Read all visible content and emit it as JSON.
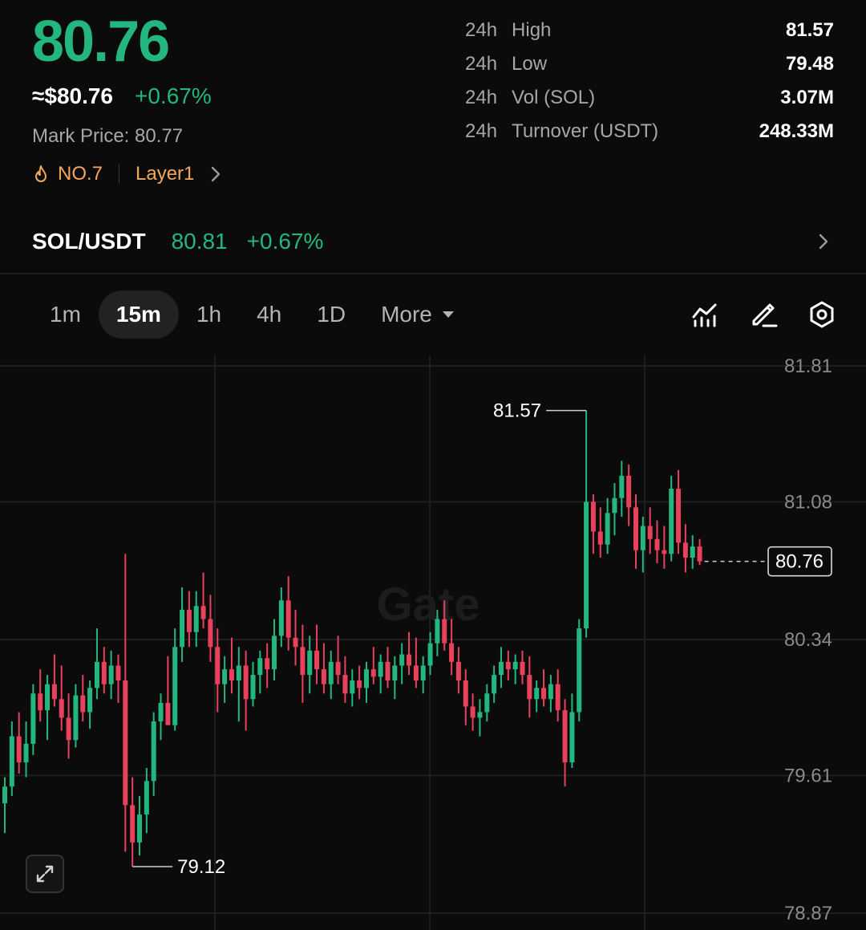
{
  "colors": {
    "up": "#23b77f",
    "down": "#e8415c",
    "accent": "#f5a65b",
    "bg": "#0b0b0b"
  },
  "header": {
    "last_price": "80.76",
    "usd_price": "≈$80.76",
    "change_pct": "+0.67%",
    "mark_price": "Mark Price: 80.77",
    "rank_label": "NO.7",
    "sector_label": "Layer1",
    "icons": {
      "rank": "fire-icon",
      "sector_more": "chevron-right-icon"
    }
  },
  "stats": [
    {
      "period": "24h",
      "label": "High",
      "value": "81.57"
    },
    {
      "period": "24h",
      "label": "Low",
      "value": "79.48"
    },
    {
      "period": "24h",
      "label": "Vol (SOL)",
      "value": "3.07M"
    },
    {
      "period": "24h",
      "label": "Turnover (USDT)",
      "value": "248.33M"
    }
  ],
  "spot_pair": {
    "name": "SOL/USDT",
    "price": "80.81",
    "change": "+0.67%",
    "icon": "chevron-right-icon"
  },
  "timeframes": {
    "tabs": [
      "1m",
      "15m",
      "1h",
      "4h",
      "1D"
    ],
    "active": "15m",
    "more_label": "More",
    "tools": [
      "indicators-icon",
      "draw-icon",
      "settings-icon"
    ]
  },
  "chart_data": {
    "type": "candlestick",
    "watermark": "Gate",
    "y_axis_ticks": [
      "81.81",
      "81.08",
      "80.34",
      "79.61",
      "78.87"
    ],
    "ylim": [
      78.87,
      81.81
    ],
    "high_marker": "81.57",
    "low_marker": "79.12",
    "current_price_label": "80.76",
    "grid": true,
    "candles": [
      {
        "o": 79.46,
        "h": 79.6,
        "l": 79.3,
        "c": 79.55
      },
      {
        "o": 79.55,
        "h": 79.9,
        "l": 79.5,
        "c": 79.82
      },
      {
        "o": 79.82,
        "h": 79.95,
        "l": 79.62,
        "c": 79.68
      },
      {
        "o": 79.68,
        "h": 79.9,
        "l": 79.6,
        "c": 79.78
      },
      {
        "o": 79.78,
        "h": 80.1,
        "l": 79.72,
        "c": 80.05
      },
      {
        "o": 80.05,
        "h": 80.18,
        "l": 79.9,
        "c": 79.96
      },
      {
        "o": 79.96,
        "h": 80.15,
        "l": 79.8,
        "c": 80.1
      },
      {
        "o": 80.1,
        "h": 80.26,
        "l": 79.98,
        "c": 80.02
      },
      {
        "o": 80.02,
        "h": 80.2,
        "l": 79.85,
        "c": 79.92
      },
      {
        "o": 79.92,
        "h": 80.05,
        "l": 79.7,
        "c": 79.8
      },
      {
        "o": 79.8,
        "h": 80.1,
        "l": 79.76,
        "c": 80.04
      },
      {
        "o": 80.04,
        "h": 80.15,
        "l": 79.9,
        "c": 79.95
      },
      {
        "o": 79.95,
        "h": 80.12,
        "l": 79.86,
        "c": 80.08
      },
      {
        "o": 80.08,
        "h": 80.4,
        "l": 80.02,
        "c": 80.22
      },
      {
        "o": 80.22,
        "h": 80.3,
        "l": 80.05,
        "c": 80.1
      },
      {
        "o": 80.1,
        "h": 80.28,
        "l": 80.02,
        "c": 80.2
      },
      {
        "o": 80.2,
        "h": 80.26,
        "l": 80.0,
        "c": 80.12
      },
      {
        "o": 80.12,
        "h": 80.8,
        "l": 79.2,
        "c": 79.45
      },
      {
        "o": 79.45,
        "h": 79.6,
        "l": 79.12,
        "c": 79.25
      },
      {
        "o": 79.25,
        "h": 79.5,
        "l": 79.18,
        "c": 79.4
      },
      {
        "o": 79.4,
        "h": 79.65,
        "l": 79.3,
        "c": 79.58
      },
      {
        "o": 79.58,
        "h": 79.95,
        "l": 79.5,
        "c": 79.9
      },
      {
        "o": 79.9,
        "h": 80.05,
        "l": 79.8,
        "c": 80.0
      },
      {
        "o": 80.0,
        "h": 80.25,
        "l": 79.95,
        "c": 79.88
      },
      {
        "o": 79.88,
        "h": 80.4,
        "l": 79.85,
        "c": 80.3
      },
      {
        "o": 80.3,
        "h": 80.62,
        "l": 80.22,
        "c": 80.5
      },
      {
        "o": 80.5,
        "h": 80.6,
        "l": 80.3,
        "c": 80.38
      },
      {
        "o": 80.38,
        "h": 80.6,
        "l": 80.3,
        "c": 80.52
      },
      {
        "o": 80.52,
        "h": 80.7,
        "l": 80.4,
        "c": 80.45
      },
      {
        "o": 80.45,
        "h": 80.58,
        "l": 80.22,
        "c": 80.3
      },
      {
        "o": 80.3,
        "h": 80.4,
        "l": 79.95,
        "c": 80.1
      },
      {
        "o": 80.1,
        "h": 80.25,
        "l": 80.0,
        "c": 80.18
      },
      {
        "o": 80.18,
        "h": 80.35,
        "l": 80.05,
        "c": 80.12
      },
      {
        "o": 80.12,
        "h": 80.3,
        "l": 79.9,
        "c": 80.2
      },
      {
        "o": 80.2,
        "h": 80.28,
        "l": 79.85,
        "c": 80.02
      },
      {
        "o": 80.02,
        "h": 80.22,
        "l": 79.98,
        "c": 80.15
      },
      {
        "o": 80.15,
        "h": 80.28,
        "l": 80.05,
        "c": 80.24
      },
      {
        "o": 80.24,
        "h": 80.32,
        "l": 80.08,
        "c": 80.18
      },
      {
        "o": 80.18,
        "h": 80.45,
        "l": 80.12,
        "c": 80.36
      },
      {
        "o": 80.36,
        "h": 80.62,
        "l": 80.3,
        "c": 80.55
      },
      {
        "o": 80.55,
        "h": 80.68,
        "l": 80.28,
        "c": 80.35
      },
      {
        "o": 80.35,
        "h": 80.5,
        "l": 80.2,
        "c": 80.3
      },
      {
        "o": 80.3,
        "h": 80.42,
        "l": 80.0,
        "c": 80.15
      },
      {
        "o": 80.15,
        "h": 80.36,
        "l": 80.05,
        "c": 80.28
      },
      {
        "o": 80.28,
        "h": 80.42,
        "l": 80.1,
        "c": 80.18
      },
      {
        "o": 80.18,
        "h": 80.32,
        "l": 80.05,
        "c": 80.1
      },
      {
        "o": 80.1,
        "h": 80.28,
        "l": 80.02,
        "c": 80.22
      },
      {
        "o": 80.22,
        "h": 80.36,
        "l": 80.1,
        "c": 80.15
      },
      {
        "o": 80.15,
        "h": 80.25,
        "l": 80.0,
        "c": 80.05
      },
      {
        "o": 80.05,
        "h": 80.18,
        "l": 79.98,
        "c": 80.12
      },
      {
        "o": 80.12,
        "h": 80.2,
        "l": 80.02,
        "c": 80.08
      },
      {
        "o": 80.08,
        "h": 80.22,
        "l": 80.0,
        "c": 80.18
      },
      {
        "o": 80.18,
        "h": 80.3,
        "l": 80.1,
        "c": 80.14
      },
      {
        "o": 80.14,
        "h": 80.26,
        "l": 80.05,
        "c": 80.22
      },
      {
        "o": 80.22,
        "h": 80.3,
        "l": 80.08,
        "c": 80.12
      },
      {
        "o": 80.12,
        "h": 80.25,
        "l": 80.02,
        "c": 80.2
      },
      {
        "o": 80.2,
        "h": 80.32,
        "l": 80.1,
        "c": 80.26
      },
      {
        "o": 80.26,
        "h": 80.38,
        "l": 80.15,
        "c": 80.2
      },
      {
        "o": 80.2,
        "h": 80.35,
        "l": 80.08,
        "c": 80.12
      },
      {
        "o": 80.12,
        "h": 80.25,
        "l": 80.05,
        "c": 80.2
      },
      {
        "o": 80.2,
        "h": 80.38,
        "l": 80.15,
        "c": 80.32
      },
      {
        "o": 80.32,
        "h": 80.5,
        "l": 80.25,
        "c": 80.45
      },
      {
        "o": 80.45,
        "h": 80.55,
        "l": 80.28,
        "c": 80.32
      },
      {
        "o": 80.32,
        "h": 80.45,
        "l": 80.15,
        "c": 80.22
      },
      {
        "o": 80.22,
        "h": 80.3,
        "l": 80.05,
        "c": 80.12
      },
      {
        "o": 80.12,
        "h": 80.18,
        "l": 79.88,
        "c": 79.98
      },
      {
        "o": 79.98,
        "h": 80.05,
        "l": 79.85,
        "c": 79.92
      },
      {
        "o": 79.92,
        "h": 80.02,
        "l": 79.82,
        "c": 79.95
      },
      {
        "o": 79.95,
        "h": 80.1,
        "l": 79.9,
        "c": 80.05
      },
      {
        "o": 80.05,
        "h": 80.2,
        "l": 80.0,
        "c": 80.15
      },
      {
        "o": 80.15,
        "h": 80.3,
        "l": 80.08,
        "c": 80.22
      },
      {
        "o": 80.22,
        "h": 80.28,
        "l": 80.12,
        "c": 80.18
      },
      {
        "o": 80.18,
        "h": 80.26,
        "l": 80.1,
        "c": 80.22
      },
      {
        "o": 80.22,
        "h": 80.28,
        "l": 80.1,
        "c": 80.15
      },
      {
        "o": 80.15,
        "h": 80.25,
        "l": 79.92,
        "c": 80.02
      },
      {
        "o": 80.02,
        "h": 80.12,
        "l": 79.95,
        "c": 80.08
      },
      {
        "o": 80.08,
        "h": 80.18,
        "l": 79.98,
        "c": 80.02
      },
      {
        "o": 80.02,
        "h": 80.15,
        "l": 79.95,
        "c": 80.1
      },
      {
        "o": 80.1,
        "h": 80.18,
        "l": 79.9,
        "c": 79.96
      },
      {
        "o": 79.96,
        "h": 80.02,
        "l": 79.55,
        "c": 79.68
      },
      {
        "o": 79.68,
        "h": 80.05,
        "l": 79.65,
        "c": 79.95
      },
      {
        "o": 79.95,
        "h": 80.45,
        "l": 79.9,
        "c": 80.4
      },
      {
        "o": 80.4,
        "h": 81.57,
        "l": 80.35,
        "c": 81.08
      },
      {
        "o": 81.08,
        "h": 81.12,
        "l": 80.8,
        "c": 80.92
      },
      {
        "o": 80.92,
        "h": 81.05,
        "l": 80.78,
        "c": 80.85
      },
      {
        "o": 80.85,
        "h": 81.1,
        "l": 80.8,
        "c": 81.02
      },
      {
        "o": 81.02,
        "h": 81.18,
        "l": 80.9,
        "c": 81.1
      },
      {
        "o": 81.1,
        "h": 81.3,
        "l": 81.0,
        "c": 81.22
      },
      {
        "o": 81.22,
        "h": 81.28,
        "l": 80.95,
        "c": 81.05
      },
      {
        "o": 81.05,
        "h": 81.12,
        "l": 80.72,
        "c": 80.82
      },
      {
        "o": 80.82,
        "h": 81.0,
        "l": 80.7,
        "c": 80.95
      },
      {
        "o": 80.95,
        "h": 81.05,
        "l": 80.8,
        "c": 80.88
      },
      {
        "o": 80.88,
        "h": 80.98,
        "l": 80.75,
        "c": 80.82
      },
      {
        "o": 80.82,
        "h": 80.95,
        "l": 80.72,
        "c": 80.8
      },
      {
        "o": 80.8,
        "h": 81.22,
        "l": 80.76,
        "c": 81.15
      },
      {
        "o": 81.15,
        "h": 81.25,
        "l": 80.8,
        "c": 80.86
      },
      {
        "o": 80.86,
        "h": 80.96,
        "l": 80.7,
        "c": 80.78
      },
      {
        "o": 80.78,
        "h": 80.9,
        "l": 80.72,
        "c": 80.84
      },
      {
        "o": 80.84,
        "h": 80.88,
        "l": 80.74,
        "c": 80.76
      }
    ]
  }
}
